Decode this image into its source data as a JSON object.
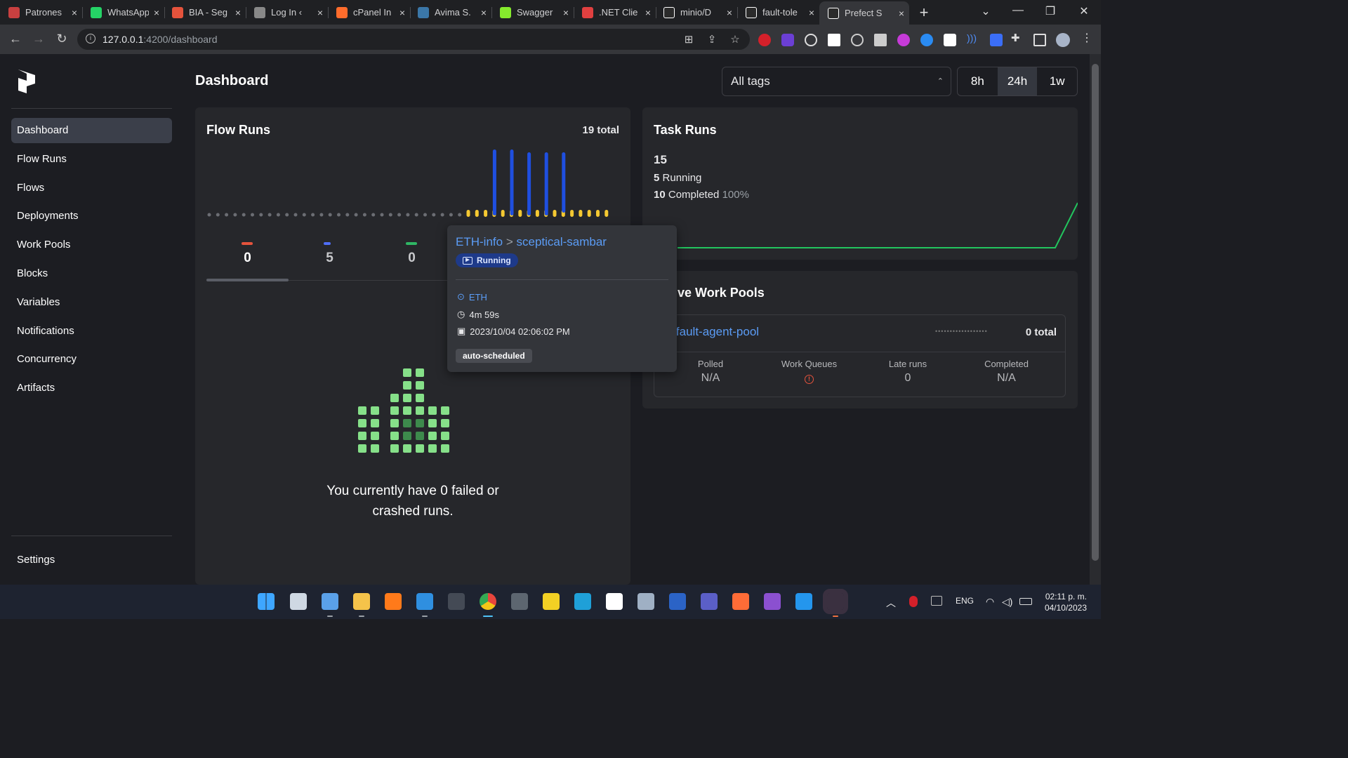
{
  "browser": {
    "tabs": [
      {
        "title": "Patrones",
        "favicon": "patreon-icon",
        "color": "#c94040"
      },
      {
        "title": "WhatsApp",
        "favicon": "whatsapp-icon",
        "color": "#25d366"
      },
      {
        "title": "BIA - Seg",
        "favicon": "bia-icon",
        "color": "#e5533c"
      },
      {
        "title": "Log In ‹",
        "favicon": "wordpress-icon",
        "color": "#888888"
      },
      {
        "title": "cPanel In",
        "favicon": "cpanel-icon",
        "color": "#ff6c2c"
      },
      {
        "title": "Avima S.",
        "favicon": "python-icon",
        "color": "#3b77a8"
      },
      {
        "title": "Swagger",
        "favicon": "swagger-icon",
        "color": "#85ea2d"
      },
      {
        "title": ".NET Clie",
        "favicon": "dotnet-icon",
        "color": "#e04040"
      },
      {
        "title": "minio/D",
        "favicon": "github-icon",
        "color": "#ffffff"
      },
      {
        "title": "fault-tole",
        "favicon": "github-icon",
        "color": "#ffffff"
      },
      {
        "title": "Prefect S",
        "favicon": "prefect-icon",
        "color": "#ffffff",
        "active": true
      }
    ],
    "url_host": "127.0.0.1",
    "url_rest": ":4200/dashboard"
  },
  "sidebar": {
    "items": [
      "Dashboard",
      "Flow Runs",
      "Flows",
      "Deployments",
      "Work Pools",
      "Blocks",
      "Variables",
      "Notifications",
      "Concurrency",
      "Artifacts"
    ],
    "active": "Dashboard",
    "settings": "Settings"
  },
  "header": {
    "title": "Dashboard",
    "tag_filter": "All tags",
    "ranges": [
      "8h",
      "24h",
      "1w"
    ],
    "active_range": "24h"
  },
  "flow_runs": {
    "title": "Flow Runs",
    "total": "19 total",
    "chart_data": {
      "type": "bar",
      "bars": [
        0,
        0,
        0,
        0,
        0,
        0,
        0,
        0,
        0,
        0,
        0,
        0,
        0,
        0,
        0,
        0,
        0,
        0,
        0,
        0,
        0,
        0,
        0,
        0,
        0,
        0,
        0,
        0,
        0,
        0,
        0,
        0,
        0,
        0,
        0,
        0,
        0,
        0,
        0,
        0,
        0,
        0,
        0,
        0,
        0,
        0,
        0
      ],
      "note_values_from_screenshot": true
    },
    "stats": [
      {
        "label_color": "#e5533c",
        "value": "0"
      },
      {
        "label_color": "#4f6ef7",
        "value": "5"
      },
      {
        "label_color": "#2fb664",
        "value": "0"
      }
    ],
    "empty_message": "You currently have 0 failed or crashed runs."
  },
  "task_runs": {
    "title": "Task Runs",
    "total": "15",
    "running_count": "5",
    "running_label": "Running",
    "completed_count": "10",
    "completed_label": "Completed",
    "completed_pct": "100%"
  },
  "work_pools": {
    "title": "Active Work Pools",
    "pool_name": "default-agent-pool",
    "pool_total": "0 total",
    "metrics": [
      {
        "label": "Polled",
        "value": "N/A"
      },
      {
        "label": "Work Queues",
        "value": ""
      },
      {
        "label": "Late runs",
        "value": "0"
      },
      {
        "label": "Completed",
        "value": "N/A"
      }
    ]
  },
  "tooltip": {
    "flow": "ETH-info",
    "separator": ">",
    "run": "sceptical-sambar",
    "state": "Running",
    "deployment": "ETH",
    "duration": "4m 59s",
    "start": "2023/10/04 02:06:02 PM",
    "tag": "auto-scheduled"
  },
  "taskbar": {
    "lang": "ENG",
    "time": "02:11 p. m.",
    "date": "04/10/2023"
  }
}
